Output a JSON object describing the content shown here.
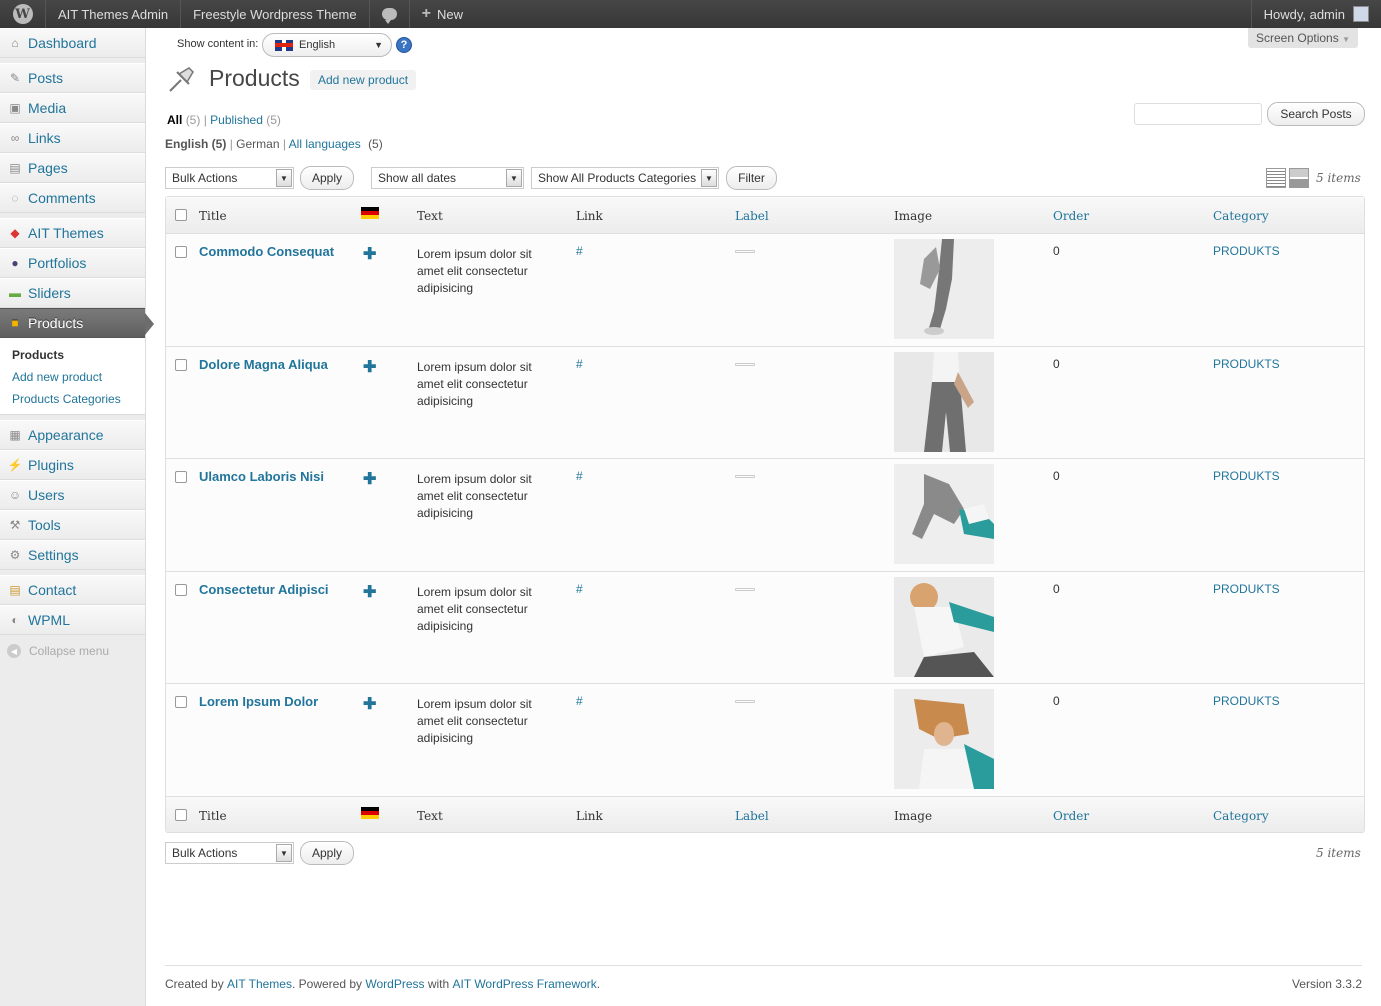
{
  "adminbar": {
    "site_name": "AIT Themes Admin",
    "theme_name": "Freestyle Wordpress Theme",
    "new_label": "New",
    "greeting": "Howdy, admin"
  },
  "sidebar": {
    "items": [
      {
        "label": "Dashboard",
        "icon": "dashboard-icon"
      },
      {
        "label": "Posts",
        "icon": "pin-icon"
      },
      {
        "label": "Media",
        "icon": "media-icon"
      },
      {
        "label": "Links",
        "icon": "link-icon"
      },
      {
        "label": "Pages",
        "icon": "page-icon"
      },
      {
        "label": "Comments",
        "icon": "comment-icon"
      },
      {
        "label": "AIT Themes",
        "icon": "ait-icon"
      },
      {
        "label": "Portfolios",
        "icon": "portfolio-icon"
      },
      {
        "label": "Sliders",
        "icon": "slider-icon"
      },
      {
        "label": "Products",
        "icon": "box-icon"
      },
      {
        "label": "Appearance",
        "icon": "appearance-icon"
      },
      {
        "label": "Plugins",
        "icon": "plugin-icon"
      },
      {
        "label": "Users",
        "icon": "users-icon"
      },
      {
        "label": "Tools",
        "icon": "tools-icon"
      },
      {
        "label": "Settings",
        "icon": "settings-icon"
      },
      {
        "label": "Contact",
        "icon": "contact-icon"
      },
      {
        "label": "WPML",
        "icon": "wpml-icon"
      }
    ],
    "submenu": {
      "products": "Products",
      "add_new": "Add new product",
      "categories": "Products Categories"
    },
    "collapse": "Collapse menu"
  },
  "top": {
    "show_content_in": "Show content in:",
    "language": "English",
    "screen_options": "Screen Options"
  },
  "header": {
    "title": "Products",
    "add_new": "Add new product"
  },
  "filters": {
    "all_label": "All",
    "all_count": "(5)",
    "published_label": "Published",
    "published_count": "(5)",
    "lang_english": "English (5)",
    "lang_german": "German",
    "lang_all": "All languages",
    "lang_all_count": "(5)",
    "search_button": "Search Posts",
    "bulk_actions": "Bulk Actions",
    "apply": "Apply",
    "dates": "Show all dates",
    "categories": "Show All Products Categories",
    "filter": "Filter",
    "items_count": "5 items"
  },
  "table": {
    "columns": {
      "title": "Title",
      "text": "Text",
      "link": "Link",
      "label": "Label",
      "image": "Image",
      "order": "Order",
      "category": "Category"
    },
    "rows": [
      {
        "title": "Commodo Consequat",
        "text": "Lorem ipsum dolor sit amet elit consectetur adipisicing",
        "link": "#",
        "order": "0",
        "category": "PRODUKTS"
      },
      {
        "title": "Dolore Magna Aliqua",
        "text": "Lorem ipsum dolor sit amet elit consectetur adipisicing",
        "link": "#",
        "order": "0",
        "category": "PRODUKTS"
      },
      {
        "title": "Ulamco Laboris Nisi",
        "text": "Lorem ipsum dolor sit amet elit consectetur adipisicing",
        "link": "#",
        "order": "0",
        "category": "PRODUKTS"
      },
      {
        "title": "Consectetur Adipisci",
        "text": "Lorem ipsum dolor sit amet elit consectetur adipisicing",
        "link": "#",
        "order": "0",
        "category": "PRODUKTS"
      },
      {
        "title": "Lorem Ipsum Dolor",
        "text": "Lorem ipsum dolor sit amet elit consectetur adipisicing",
        "link": "#",
        "order": "0",
        "category": "PRODUKTS"
      }
    ]
  },
  "footer": {
    "created_by": "Created by",
    "ait": "AIT Themes",
    "powered_by": ". Powered by",
    "wordpress": "WordPress",
    "with": "with",
    "framework": "AIT WordPress Framework",
    "dot": ".",
    "version": "Version 3.3.2"
  }
}
